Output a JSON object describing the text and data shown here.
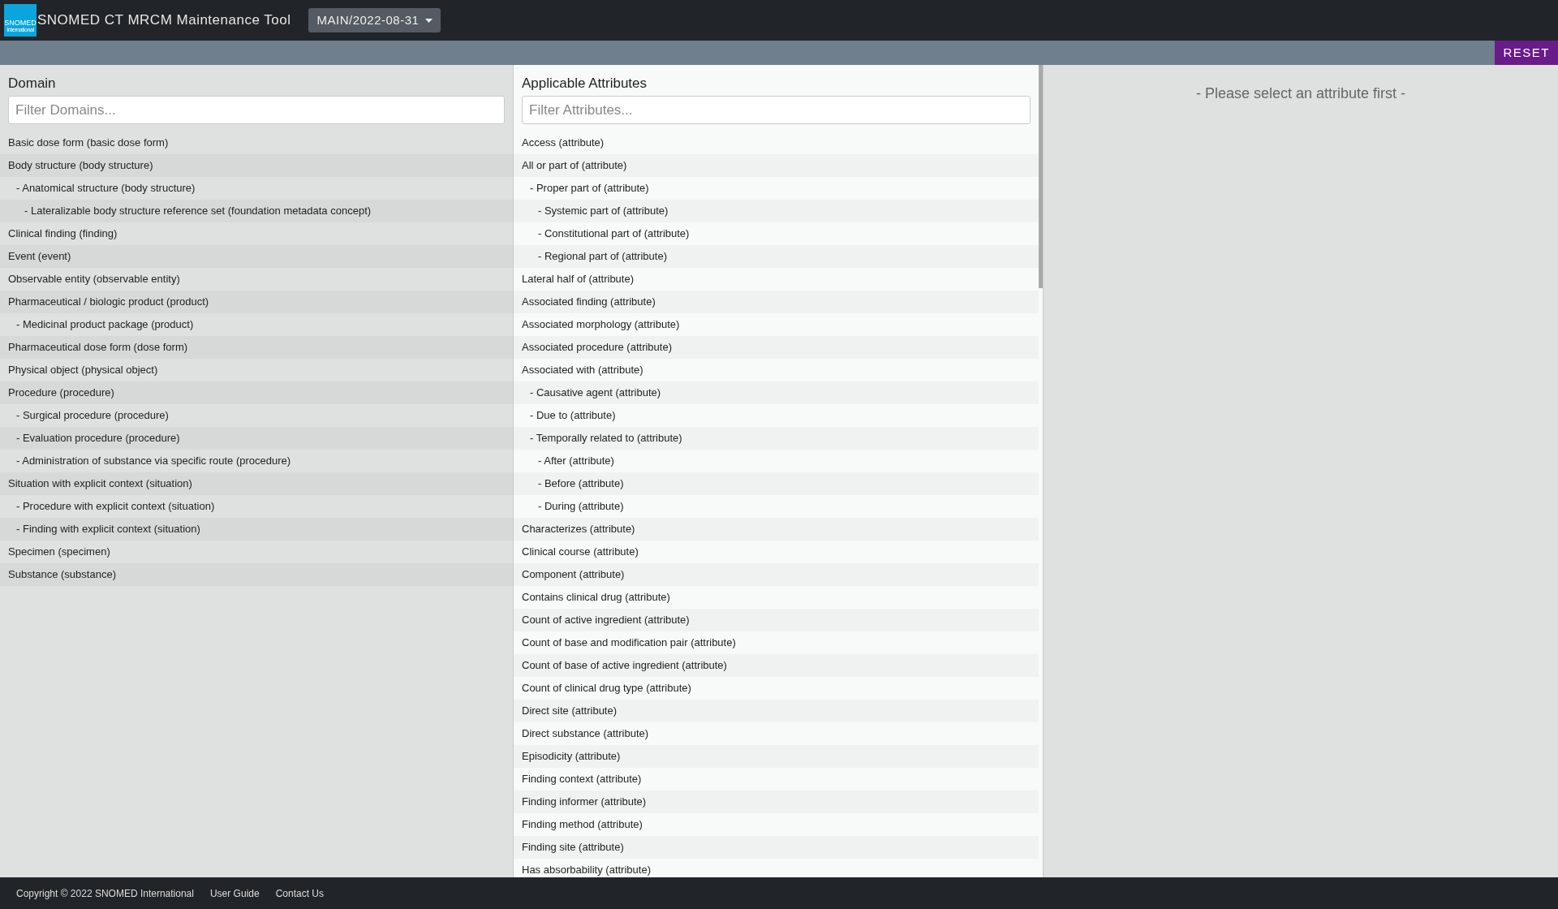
{
  "header": {
    "logo": {
      "line_1": "SNOMED",
      "line_2": "International"
    },
    "title": "SNOMED CT MRCM Maintenance Tool",
    "branch_dropdown": "MAIN/2022-08-31"
  },
  "toolbar": {
    "reset_button": "RESET"
  },
  "domain_panel": {
    "title": "Domain",
    "search": {
      "placeholder": "Filter Domains..."
    },
    "items": [
      {
        "label": "Basic dose form (basic dose form)"
      },
      {
        "label": "Body structure (body structure)",
        "children": [
          {
            "label": "- Anatomical structure (body structure)",
            "children": [
              {
                "label": "- Lateralizable body structure reference set (foundation metadata concept)"
              }
            ]
          }
        ]
      },
      {
        "label": "Clinical finding (finding)"
      },
      {
        "label": "Event (event)"
      },
      {
        "label": "Observable entity (observable entity)"
      },
      {
        "label": "Pharmaceutical / biologic product (product)",
        "children": [
          {
            "label": "- Medicinal product package (product)"
          }
        ]
      },
      {
        "label": "Pharmaceutical dose form (dose form)"
      },
      {
        "label": "Physical object (physical object)"
      },
      {
        "label": "Procedure (procedure)",
        "children": [
          {
            "label": "- Surgical procedure (procedure)"
          },
          {
            "label": "- Evaluation procedure (procedure)"
          },
          {
            "label": "- Administration of substance via specific route (procedure)"
          }
        ]
      },
      {
        "label": "Situation with explicit context (situation)",
        "children": [
          {
            "label": "- Procedure with explicit context (situation)"
          },
          {
            "label": "- Finding with explicit context (situation)"
          }
        ]
      },
      {
        "label": "Specimen (specimen)"
      },
      {
        "label": "Substance (substance)"
      }
    ]
  },
  "attributes_panel": {
    "title": "Applicable Attributes",
    "search": {
      "placeholder": "Filter Attributes..."
    },
    "items": [
      {
        "label": "Access (attribute)"
      },
      {
        "label": "All or part of (attribute)",
        "children": [
          {
            "label": "- Proper part of (attribute)",
            "children": [
              {
                "label": "- Systemic part of (attribute)"
              },
              {
                "label": "- Constitutional part of (attribute)"
              },
              {
                "label": "- Regional part of (attribute)"
              }
            ]
          }
        ]
      },
      {
        "label": "Lateral half of (attribute)"
      },
      {
        "label": "Associated finding (attribute)"
      },
      {
        "label": "Associated morphology (attribute)"
      },
      {
        "label": "Associated procedure (attribute)"
      },
      {
        "label": "Associated with (attribute)",
        "children": [
          {
            "label": "- Causative agent (attribute)"
          },
          {
            "label": "- Due to (attribute)"
          },
          {
            "label": "- Temporally related to (attribute)",
            "children": [
              {
                "label": "- After (attribute)"
              },
              {
                "label": "- Before (attribute)"
              },
              {
                "label": "- During (attribute)"
              }
            ]
          }
        ]
      },
      {
        "label": "Characterizes (attribute)"
      },
      {
        "label": "Clinical course (attribute)"
      },
      {
        "label": "Component (attribute)"
      },
      {
        "label": "Contains clinical drug (attribute)"
      },
      {
        "label": "Count of active ingredient (attribute)"
      },
      {
        "label": "Count of base and modification pair (attribute)"
      },
      {
        "label": "Count of base of active ingredient (attribute)"
      },
      {
        "label": "Count of clinical drug type (attribute)"
      },
      {
        "label": "Direct site (attribute)"
      },
      {
        "label": "Direct substance (attribute)"
      },
      {
        "label": "Episodicity (attribute)"
      },
      {
        "label": "Finding context (attribute)"
      },
      {
        "label": "Finding informer (attribute)"
      },
      {
        "label": "Finding method (attribute)"
      },
      {
        "label": "Finding site (attribute)"
      },
      {
        "label": "Has absorbability (attribute)"
      }
    ]
  },
  "detail_panel": {
    "message": "- Please select an attribute first -"
  },
  "footer": {
    "copyright": "Copyright © 2022 SNOMED International",
    "links": [
      "User Guide",
      "Contact Us"
    ]
  }
}
